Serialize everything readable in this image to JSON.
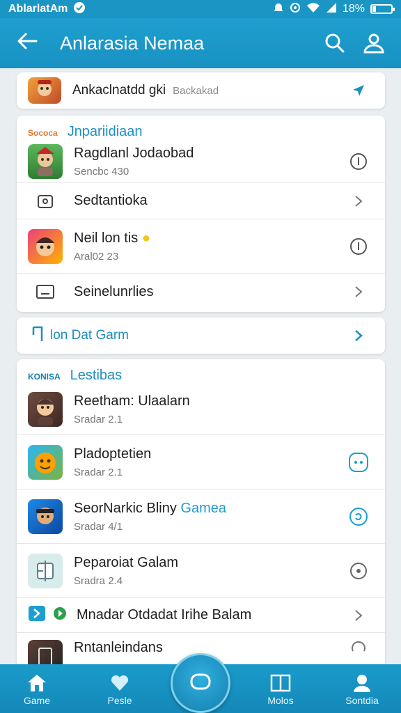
{
  "status": {
    "app": "AblarlatAm",
    "battery": "18%",
    "battery_level": 0.18
  },
  "appbar": {
    "title": "Anlarasia Nemaa"
  },
  "search_card": {
    "label": "Ankaclnatdd gki",
    "hint": "Backakad"
  },
  "section1": {
    "tag": "Sococa",
    "title": "Jnpariidiaan",
    "rows": [
      {
        "title": "Ragdlanl Jodaobad",
        "subtitle": "Sencbc 430"
      },
      {
        "title": "Sedtantioka"
      },
      {
        "title": "Neil lon tis",
        "subtitle": "Aral02 23"
      },
      {
        "title": "Seinelunrlies"
      }
    ]
  },
  "link_card": {
    "label": "lon Dat Garm"
  },
  "section2": {
    "tag": "KONISA",
    "title": "Lestibas",
    "rows": [
      {
        "title": "Reetham: Ulaalarn",
        "subtitle": "Sradar 2.1"
      },
      {
        "title": "Pladoptetien",
        "subtitle": "Sradar 2.1"
      },
      {
        "title": "SeorNarkic Bliny",
        "accent": "Gamea",
        "subtitle": "Sradar 4/1"
      },
      {
        "title": "Peparoiat Galam",
        "subtitle": "Sradra 2.4"
      },
      {
        "title": "Mnadar Otdadat Irihe Balam"
      },
      {
        "title": "Rntanleindans"
      }
    ]
  },
  "bottom_nav": [
    {
      "label": "Game"
    },
    {
      "label": "Pesle"
    },
    {
      "label": "Molos"
    },
    {
      "label": "Sontdia"
    }
  ],
  "colors": {
    "primary": "#1a95c4",
    "accent_text": "#1b8fbf",
    "tag_orange": "#e2762a",
    "tag_blue": "#167fae"
  }
}
